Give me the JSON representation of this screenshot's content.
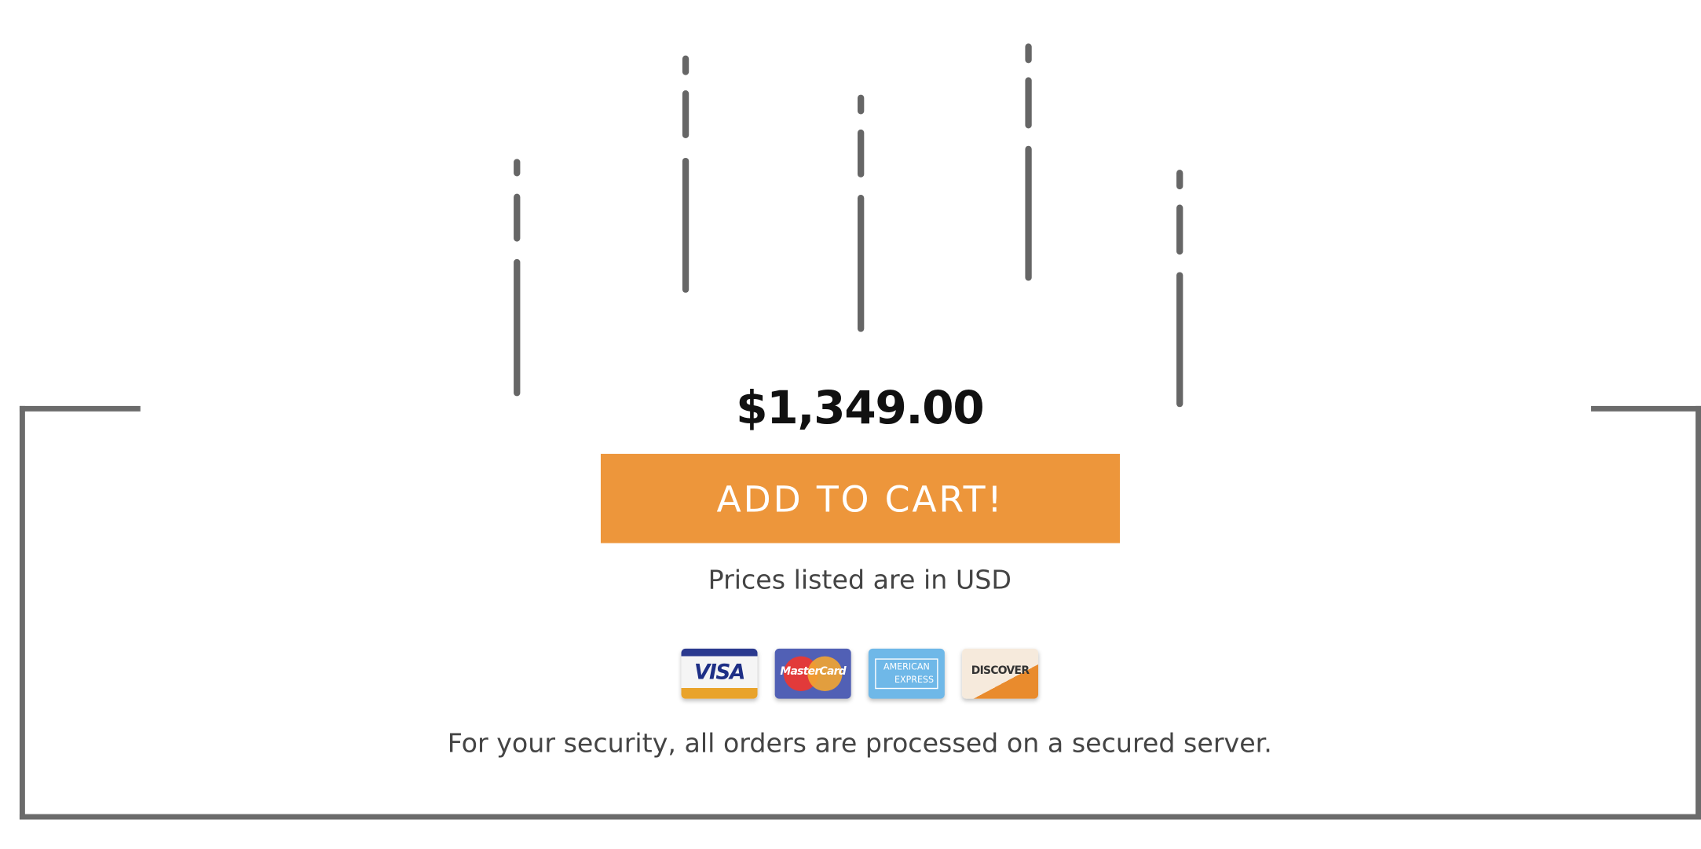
{
  "product": {
    "price": "$1,349.00",
    "add_to_cart_label": "ADD TO CART!",
    "currency_note": "Prices listed are in USD",
    "security_note": "For your security, all orders are processed on a secured server."
  },
  "payment_methods": [
    {
      "name": "visa",
      "label": "VISA"
    },
    {
      "name": "mastercard",
      "label": "MasterCard"
    },
    {
      "name": "american-express",
      "label_line1": "AMERICAN",
      "label_line2": "EXPRESS"
    },
    {
      "name": "discover",
      "label": "DISCOVER"
    }
  ],
  "colors": {
    "accent": "#ed963b",
    "frame": "#6b6b6b",
    "text": "#444444",
    "price": "#111111"
  }
}
